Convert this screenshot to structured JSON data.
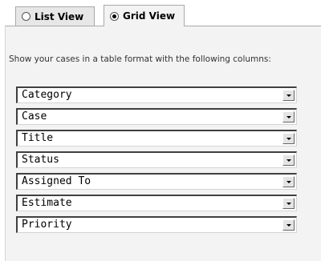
{
  "tabs": [
    {
      "label": "List View",
      "selected": false
    },
    {
      "label": "Grid View",
      "selected": true
    }
  ],
  "description": "Show your cases in a table format with the following columns:",
  "columns": [
    "Category",
    "Case",
    "Title",
    "Status",
    "Assigned To",
    "Estimate",
    "Priority"
  ]
}
